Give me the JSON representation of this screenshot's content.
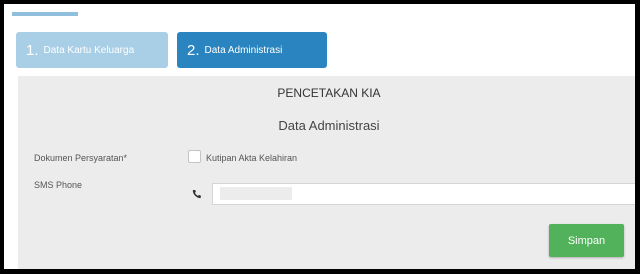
{
  "wizard": {
    "steps": [
      {
        "number": "1.",
        "label": "Data Kartu Keluarga"
      },
      {
        "number": "2.",
        "label": "Data Administrasi"
      }
    ]
  },
  "form": {
    "title": "PENCETAKAN KIA",
    "subtitle": "Data Administrasi",
    "documents_label": "Dokumen Persyaratan*",
    "documents_option": "Kutipan Akta Kelahiran",
    "sms_label": "SMS Phone",
    "sms_value": "",
    "save_label": "Simpan"
  },
  "colors": {
    "step_inactive": "#a9cfe6",
    "step_active": "#2a84bf",
    "save_button": "#52b25b"
  },
  "icons": {
    "phone": "phone-icon"
  }
}
